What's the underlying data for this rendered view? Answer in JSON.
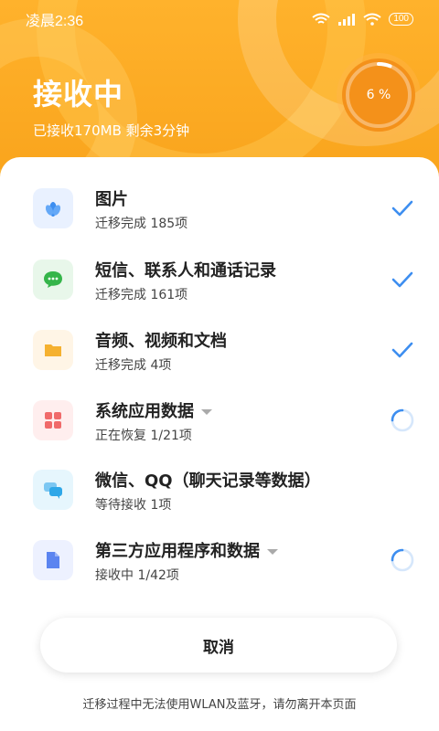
{
  "status_bar": {
    "time": "凌晨2:36",
    "battery": "100"
  },
  "header": {
    "title": "接收中",
    "subtitle": "已接收170MB 剩余3分钟",
    "progress_text": "6 %",
    "progress_value": 6
  },
  "items": [
    {
      "name": "图片",
      "status": "迁移完成 185项",
      "icon": "flower-icon",
      "state": "done"
    },
    {
      "name": "短信、联系人和通话记录",
      "status": "迁移完成 161项",
      "icon": "message-icon",
      "state": "done"
    },
    {
      "name": "音频、视频和文档",
      "status": "迁移完成 4项",
      "icon": "folder-icon",
      "state": "done"
    },
    {
      "name": "系统应用数据",
      "status": "正在恢复 1/21项",
      "icon": "apps-grid-icon",
      "state": "loading",
      "expandable": true
    },
    {
      "name": "微信、QQ（聊天记录等数据）",
      "status": "等待接收 1项",
      "icon": "chat-bubbles-icon",
      "state": "waiting"
    },
    {
      "name": "第三方应用程序和数据",
      "status": "接收中 1/42项",
      "icon": "document-icon",
      "state": "loading",
      "expandable": true
    }
  ],
  "cancel_label": "取消",
  "footer_note": "迁移过程中无法使用WLAN及蓝牙，请勿离开本页面",
  "colors": {
    "accent": "#f9a41c",
    "check": "#3d8ef0"
  }
}
